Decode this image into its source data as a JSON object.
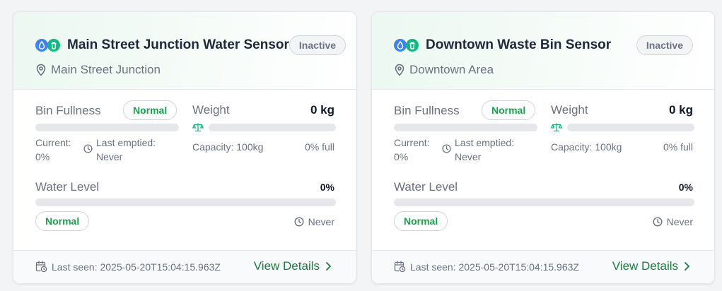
{
  "colors": {
    "accent_green": "#16a34a",
    "water_blue": "#3b82f6",
    "bin_green": "#10b981",
    "muted": "#6b7280"
  },
  "cards": [
    {
      "title": "Main Street Junction Water Sensor",
      "status": "Inactive",
      "location": "Main Street Junction",
      "bin_fullness": {
        "label": "Bin Fullness",
        "status": "Normal",
        "percent": 0,
        "current_label": "Current:",
        "current_value": "0%",
        "last_emptied_label": "Last emptied:",
        "last_emptied_value": "Never"
      },
      "weight": {
        "label": "Weight",
        "value": "0 kg",
        "percent": 0,
        "capacity": "Capacity: 100kg",
        "full": "0% full"
      },
      "water_level": {
        "label": "Water Level",
        "value": "0%",
        "percent": 0,
        "status": "Normal",
        "time": "Never"
      },
      "footer": {
        "last_seen": "Last seen: 2025-05-20T15:04:15.963Z",
        "view_details": "View Details"
      }
    },
    {
      "title": "Downtown Waste Bin Sensor",
      "status": "Inactive",
      "location": "Downtown Area",
      "bin_fullness": {
        "label": "Bin Fullness",
        "status": "Normal",
        "percent": 0,
        "current_label": "Current:",
        "current_value": "0%",
        "last_emptied_label": "Last emptied:",
        "last_emptied_value": "Never"
      },
      "weight": {
        "label": "Weight",
        "value": "0 kg",
        "percent": 0,
        "capacity": "Capacity: 100kg",
        "full": "0% full"
      },
      "water_level": {
        "label": "Water Level",
        "value": "0%",
        "percent": 0,
        "status": "Normal",
        "time": "Never"
      },
      "footer": {
        "last_seen": "Last seen: 2025-05-20T15:04:15.963Z",
        "view_details": "View Details"
      }
    }
  ]
}
